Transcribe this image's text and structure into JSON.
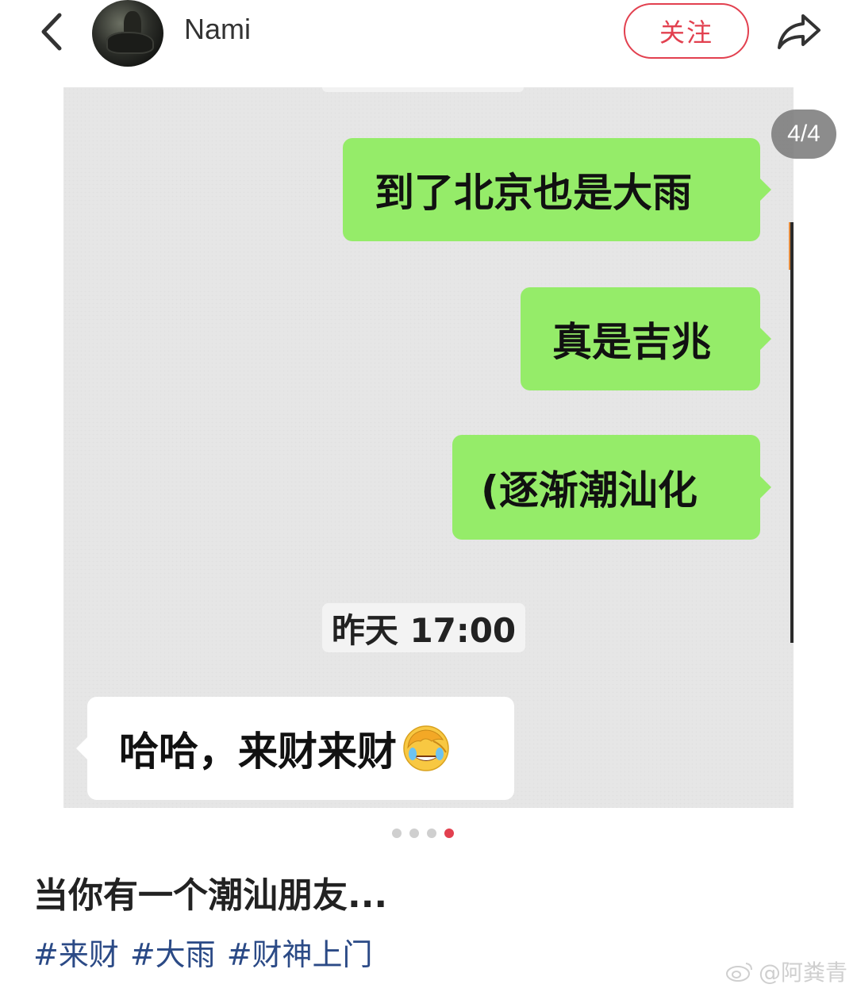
{
  "header": {
    "username": "Nami",
    "follow_label": "关注"
  },
  "post": {
    "page_indicator": "4/4",
    "chat": {
      "messages": [
        {
          "side": "sent",
          "text": "到了北京也是大雨"
        },
        {
          "side": "sent",
          "text": "真是吉兆"
        },
        {
          "side": "sent",
          "text": "(逐渐潮汕化"
        },
        {
          "side": "received",
          "text": "哈哈，来财来财"
        }
      ],
      "timestamp": "昨天 17:00"
    },
    "pagination": {
      "total": 4,
      "current": 4
    },
    "caption": "当你有一个潮汕朋友...",
    "tags": [
      "#来财",
      "#大雨",
      "#财神上门"
    ]
  },
  "watermark": "@阿粪青",
  "colors": {
    "accent": "#e2404f",
    "sent_bubble": "#95ec69",
    "tag": "#2b4a86"
  },
  "icons": {
    "back": "chevron-left-icon",
    "share": "share-arrow-icon",
    "emoji": "face-palm-emoji-icon",
    "watermark_logo": "weibo-logo-icon"
  }
}
